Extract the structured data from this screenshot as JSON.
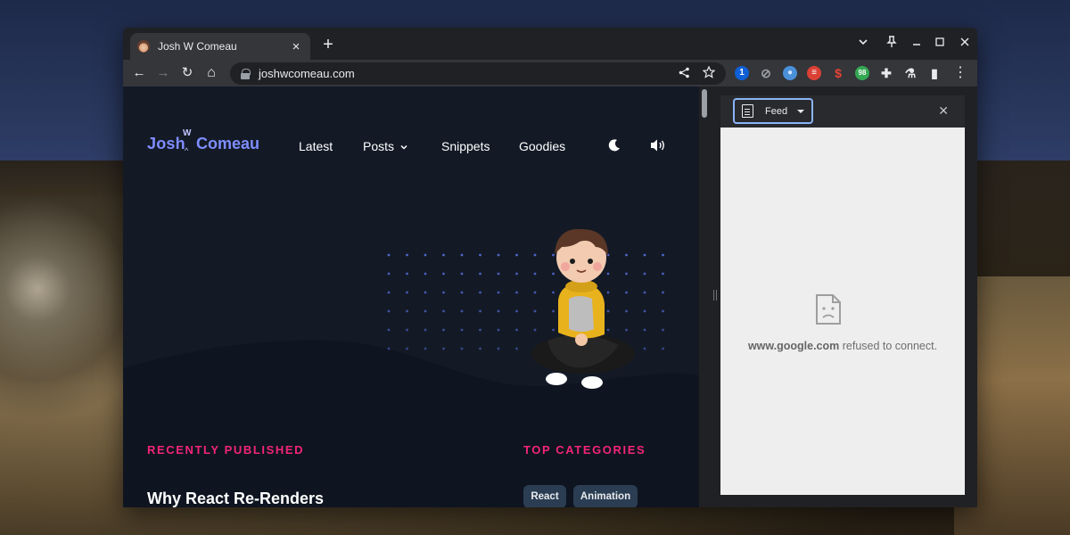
{
  "tab": {
    "title": "Josh W Comeau",
    "close": "×"
  },
  "new_tab": "+",
  "window_controls": {
    "tab_search": "⌄",
    "pin": "📌",
    "minimize": "—",
    "maximize": "☐",
    "close": "✕"
  },
  "toolbar": {
    "back": "←",
    "forward": "→",
    "reload": "↻",
    "home": "⌂",
    "url": "joshwcomeau.com",
    "share_icon": "share-icon",
    "bookmark_icon": "star-icon",
    "extensions": [
      {
        "name": "1password-extension",
        "label": "1",
        "bg": "#0f5fd6",
        "fg": "#ffffff"
      },
      {
        "name": "blocker-extension",
        "label": "⊘",
        "bg": "#35363a",
        "fg": "#9aa0a6"
      },
      {
        "name": "circle-extension",
        "label": "●",
        "bg": "#4a90d9",
        "fg": "#cfe2ff"
      },
      {
        "name": "todoist-extension",
        "label": "≡",
        "bg": "#db4035",
        "fg": "#ffffff"
      },
      {
        "name": "dollar-extension",
        "label": "$",
        "bg": "#35363a",
        "fg": "#ea4335"
      },
      {
        "name": "counter-extension",
        "label": "98",
        "bg": "#34a853",
        "fg": "#ffffff"
      },
      {
        "name": "puzzle-extension",
        "label": "✚",
        "bg": "#35363a",
        "fg": "#e8eaed"
      },
      {
        "name": "flask-extension",
        "label": "⚗",
        "bg": "#35363a",
        "fg": "#e8eaed"
      },
      {
        "name": "side-panel-toggle",
        "label": "▮",
        "bg": "#35363a",
        "fg": "#e8eaed"
      }
    ],
    "menu": "⋮"
  },
  "site": {
    "logo_left": "Josh",
    "logo_w": "W",
    "logo_a": "^",
    "logo_right": "Comeau",
    "nav": [
      "Latest",
      "Posts",
      "Snippets",
      "Goodies"
    ],
    "recently_published": "RECENTLY PUBLISHED",
    "top_categories": "TOP CATEGORIES",
    "post_title": "Why React Re-Renders",
    "categories": [
      "React",
      "Animation"
    ],
    "accent": "#f2247a",
    "brand": "#7e8dff"
  },
  "side_panel": {
    "dropdown_label": "Feed",
    "close": "✕",
    "error_host": "www.google.com",
    "error_text": " refused to connect."
  }
}
